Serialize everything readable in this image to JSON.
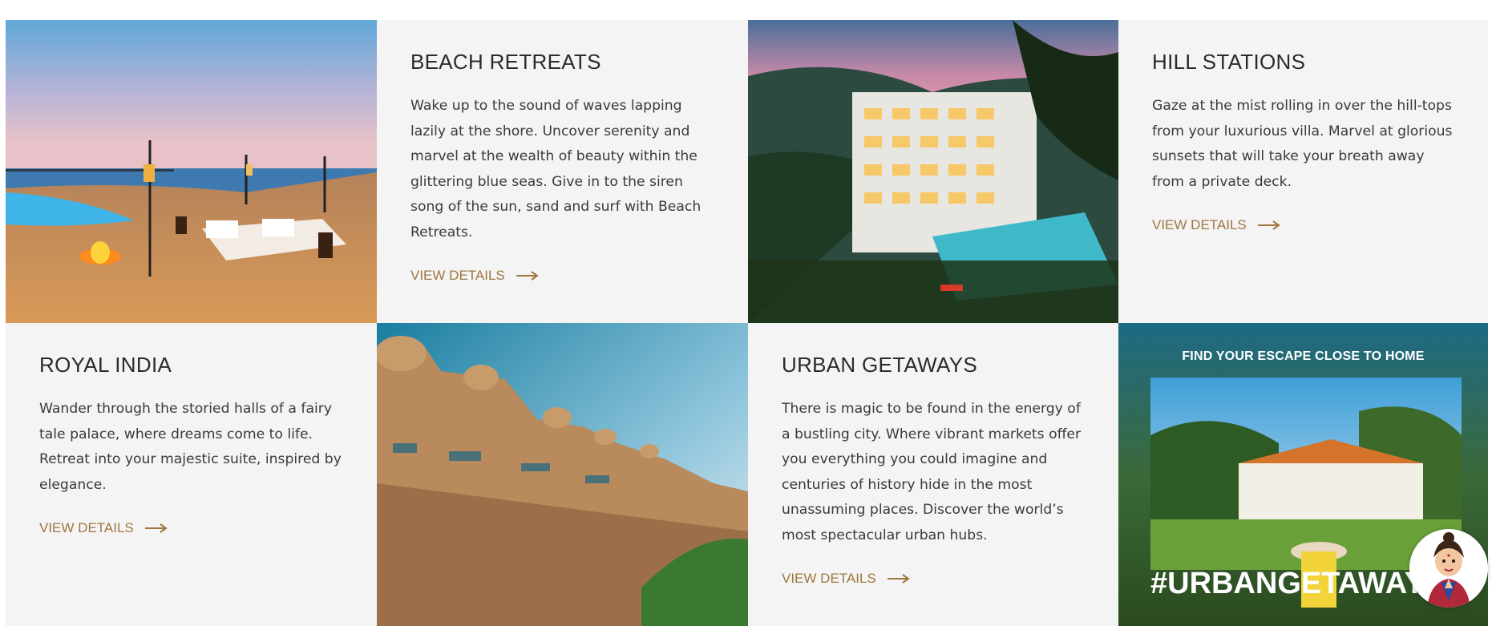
{
  "tiles": [
    {
      "title": "BEACH RETREATS",
      "description": "Wake up to the sound of waves lapping lazily at the shore. Uncover serenity and marvel at the wealth of beauty within the glittering blue seas. Give in to the siren song of the sun, sand and surf with Beach Retreats.",
      "link_label": "VIEW DETAILS"
    },
    {
      "title": "HILL STATIONS",
      "description": "Gaze at the mist rolling in over the hill-tops from your luxurious villa. Marvel at glorious sunsets that will take your breath away from a private deck.",
      "link_label": "VIEW DETAILS"
    },
    {
      "title": "ROYAL INDIA",
      "description": "Wander through the storied halls of a fairy tale palace, where dreams come to life. Retreat into your majestic suite, inspired by elegance.",
      "link_label": "VIEW DETAILS"
    },
    {
      "title": "URBAN GETAWAYS",
      "description": "There is magic to be found in the energy of a bustling city. Where vibrant markets offer you everything you could imagine and centuries of history hide in the most unassuming places. Discover the world’s most spectacular urban hubs.",
      "link_label": "VIEW DETAILS"
    }
  ],
  "banner": {
    "heading": "FIND YOUR ESCAPE CLOSE TO HOME",
    "hashtag": "#URBANGETAWAYS"
  },
  "colors": {
    "accent": "#a0763f",
    "tile_background": "#f4f4f4",
    "title_text": "#2b2b2b"
  },
  "icons": {
    "link_arrow": "arrow-right-icon",
    "chat_avatar": "assistant-avatar-icon"
  }
}
